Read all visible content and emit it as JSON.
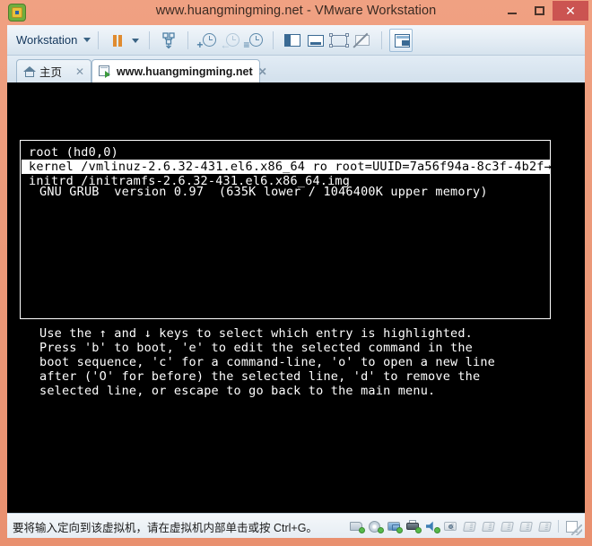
{
  "window": {
    "title": "www.huangmingming.net - VMware Workstation",
    "logo_icon": "vmware-logo-icon",
    "minimize_label": "–",
    "maximize_label": "□",
    "close_label": "✕"
  },
  "toolbar": {
    "menu_label": "Workstation",
    "buttons": [
      {
        "name": "pause-button",
        "icon": "pause-icon"
      },
      {
        "name": "pause-dropdown",
        "icon": "chevron-down-icon"
      },
      {
        "name": "send-ctrl-alt-del-button",
        "icon": "keyboard-send-icon"
      },
      {
        "name": "take-snapshot-button",
        "icon": "snapshot-add-icon"
      },
      {
        "name": "revert-snapshot-button",
        "icon": "snapshot-revert-icon"
      },
      {
        "name": "snapshot-manager-button",
        "icon": "snapshot-manager-icon"
      },
      {
        "name": "show-library-button",
        "icon": "library-panel-icon"
      },
      {
        "name": "console-view-button",
        "icon": "console-view-icon"
      },
      {
        "name": "fullscreen-button",
        "icon": "fullscreen-icon"
      },
      {
        "name": "unity-mode-button",
        "icon": "unity-mode-disabled-icon"
      },
      {
        "name": "show-thumbnail-bar-button",
        "icon": "thumbnail-bar-icon"
      }
    ]
  },
  "tabs": [
    {
      "label": "主页",
      "icon": "home-icon",
      "close": "✕",
      "active": false
    },
    {
      "label": "www.huangmingming.net",
      "icon": "vm-powered-on-icon",
      "close": "✕",
      "active": true
    }
  ],
  "vm_screen": {
    "grub_header": "GNU GRUB  version 0.97  (635K lower / 1046400K upper memory)",
    "entries": [
      {
        "text": "root (hd0,0)",
        "selected": false
      },
      {
        "text": "kernel /vmlinuz-2.6.32-431.el6.x86_64 ro root=UUID=7a56f94a-8c3f-4b2f→",
        "selected": true
      },
      {
        "text": "initrd /initramfs-2.6.32-431.el6.x86_64.img",
        "selected": false
      }
    ],
    "help_text": "Use the ↑ and ↓ keys to select which entry is highlighted.\nPress 'b' to boot, 'e' to edit the selected command in the\nboot sequence, 'c' for a command-line, 'o' to open a new line\nafter ('O' for before) the selected line, 'd' to remove the\nselected line, or escape to go back to the main menu."
  },
  "status_bar": {
    "message": "要将输入定向到该虚拟机，请在虚拟机内部单击或按 Ctrl+G。",
    "tray_icons": [
      "hard-disk-icon",
      "cd-dvd-icon",
      "network-adapter-icon",
      "printer-icon",
      "sound-card-icon",
      "camera-icon",
      "usb-device-icon",
      "usb-device-2-icon",
      "usb-device-3-icon",
      "usb-device-4-icon",
      "usb-device-5-icon",
      "notes-icon"
    ],
    "resize_grip": "resize-grip-icon"
  },
  "colors": {
    "window_frame": "#eb9878",
    "close_button": "#cb5451",
    "toolbar_bg": "#e3ecf4",
    "vm_screen_bg": "#000000",
    "grub_text": "#ffffff",
    "accent_orange": "#e08b30"
  }
}
